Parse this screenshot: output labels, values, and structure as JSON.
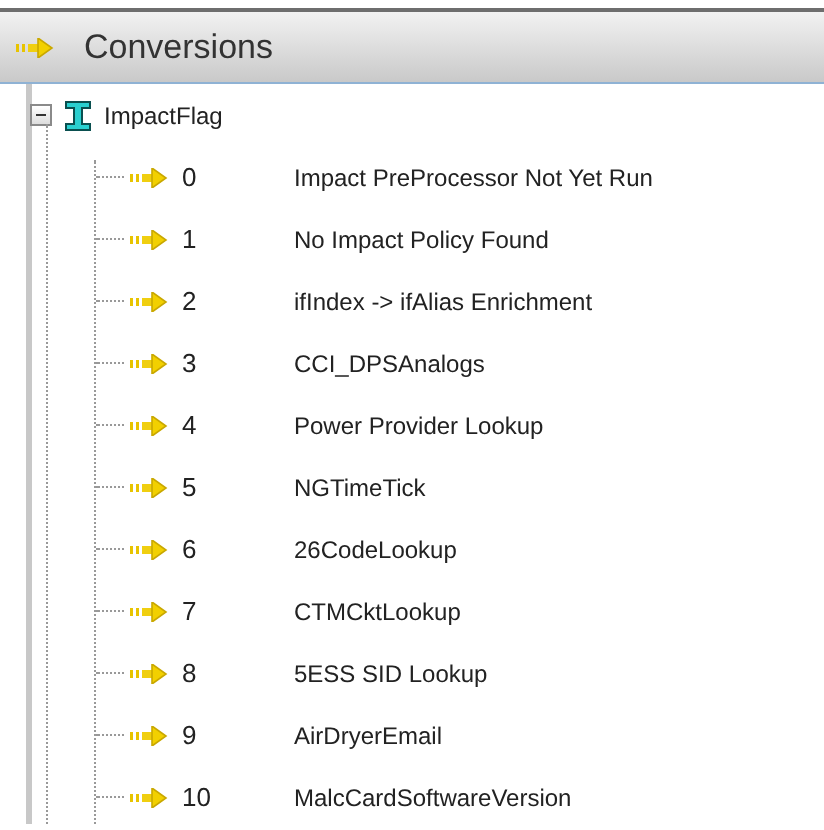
{
  "header": {
    "title": "Conversions"
  },
  "tree": {
    "label": "ImpactFlag",
    "expanded": true,
    "children": [
      {
        "code": "0",
        "name": "Impact PreProcessor Not Yet Run"
      },
      {
        "code": "1",
        "name": "No Impact Policy Found"
      },
      {
        "code": "2",
        "name": "ifIndex -> ifAlias Enrichment"
      },
      {
        "code": "3",
        "name": "CCI_DPSAnalogs"
      },
      {
        "code": "4",
        "name": "Power Provider Lookup"
      },
      {
        "code": "5",
        "name": "NGTimeTick"
      },
      {
        "code": "6",
        "name": "26CodeLookup"
      },
      {
        "code": "7",
        "name": "CTMCktLookup"
      },
      {
        "code": "8",
        "name": "5ESS SID Lookup"
      },
      {
        "code": "9",
        "name": "AirDryerEmail"
      },
      {
        "code": "10",
        "name": "MalcCardSoftwareVersion"
      }
    ]
  }
}
